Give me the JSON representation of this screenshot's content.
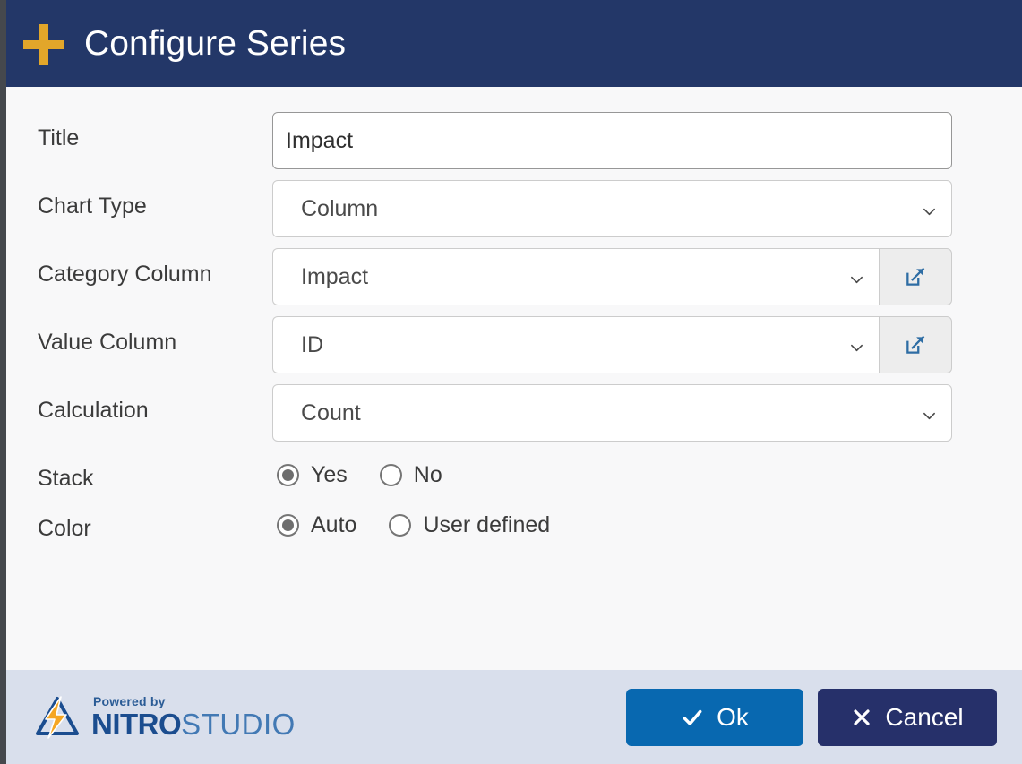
{
  "window": {
    "title": "Configure Series",
    "title_icon": "plus-icon",
    "header_bg": "#233768",
    "accent_gold": "#e2a62a"
  },
  "form": {
    "rows": [
      {
        "label": "Title",
        "type": "text",
        "value": "Impact",
        "placeholder": ""
      },
      {
        "label": "Chart Type",
        "type": "select",
        "value": "Column"
      },
      {
        "label": "Category Column",
        "type": "select-with-button",
        "value": "Impact",
        "button_icon": "external-link-icon"
      },
      {
        "label": "Value Column",
        "type": "select-with-button",
        "value": "ID",
        "button_icon": "external-link-icon"
      },
      {
        "label": "Calculation",
        "type": "select",
        "value": "Count"
      },
      {
        "label": "Stack",
        "type": "radio"
      },
      {
        "label": "Color",
        "type": "radio"
      }
    ],
    "title": {
      "label": "Title",
      "value": "Impact"
    },
    "chart_type": {
      "label": "Chart Type",
      "value": "Column"
    },
    "category_column": {
      "label": "Category Column",
      "value": "Impact"
    },
    "value_column": {
      "label": "Value Column",
      "value": "ID"
    },
    "calculation": {
      "label": "Calculation",
      "value": "Count"
    },
    "stack": {
      "label": "Stack",
      "options": [
        {
          "label": "Yes",
          "selected": true
        },
        {
          "label": "No",
          "selected": false
        }
      ]
    },
    "color": {
      "label": "Color",
      "options": [
        {
          "label": "Auto",
          "selected": true
        },
        {
          "label": "User defined",
          "selected": false
        }
      ]
    }
  },
  "footer": {
    "brand": {
      "powered_by": "Powered by",
      "name_bold": "NITRO",
      "name_light": "STUDIO",
      "logo_icon": "nitro-lightning-logo"
    },
    "buttons": {
      "ok": {
        "label": "Ok",
        "icon": "check-icon",
        "color": "#0868b0"
      },
      "cancel": {
        "label": "Cancel",
        "icon": "close-icon",
        "color": "#26306a"
      }
    }
  }
}
